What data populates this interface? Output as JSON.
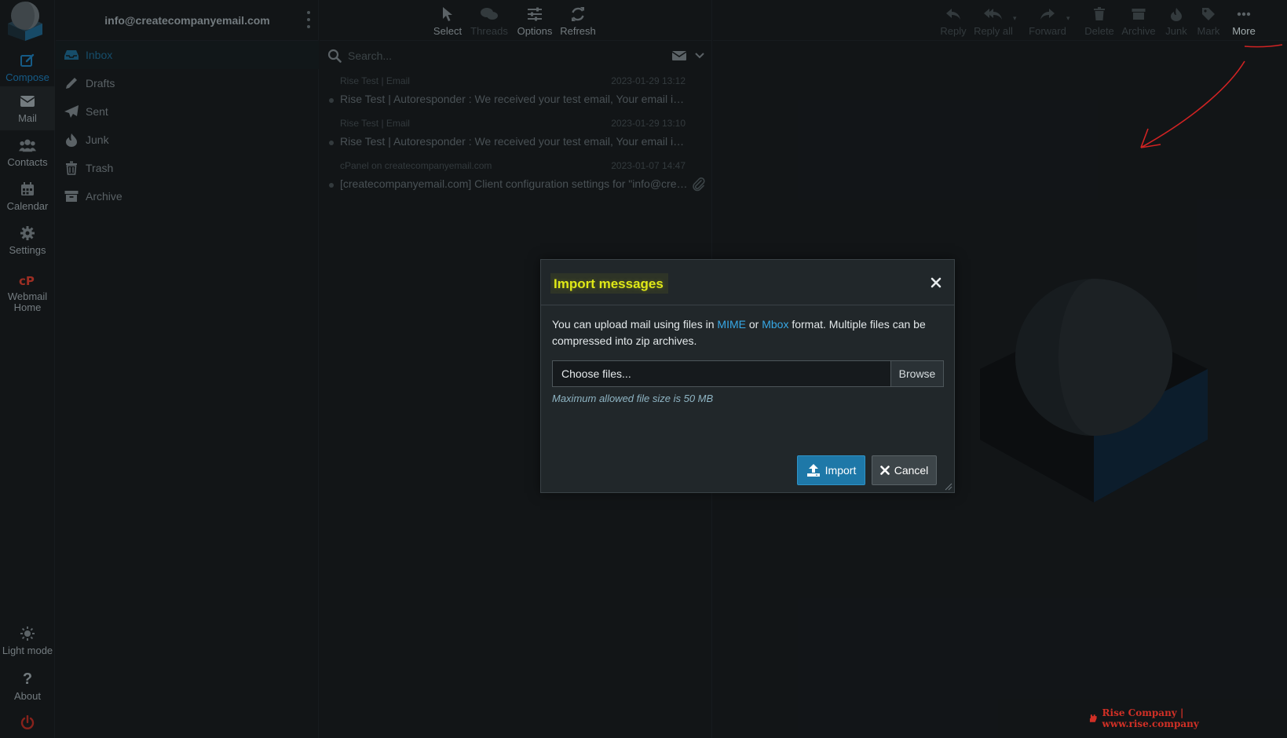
{
  "account": {
    "email": "info@createcompanyemail.com"
  },
  "rail": {
    "compose": "Compose",
    "mail": "Mail",
    "contacts": "Contacts",
    "calendar": "Calendar",
    "settings": "Settings",
    "webmail_home_1": "Webmail",
    "webmail_home_2": "Home",
    "light_mode": "Light mode",
    "about": "About"
  },
  "folders": [
    {
      "label": "Inbox",
      "icon": "inbox-icon"
    },
    {
      "label": "Drafts",
      "icon": "pencil-icon"
    },
    {
      "label": "Sent",
      "icon": "paper-plane-icon"
    },
    {
      "label": "Junk",
      "icon": "fire-icon"
    },
    {
      "label": "Trash",
      "icon": "trash-icon"
    },
    {
      "label": "Archive",
      "icon": "archive-icon"
    }
  ],
  "list_toolbar": {
    "select": "Select",
    "threads": "Threads",
    "options": "Options",
    "refresh": "Refresh"
  },
  "search": {
    "placeholder": "Search..."
  },
  "messages": [
    {
      "from": "Rise Test | Email",
      "date": "2023-01-29 13:12",
      "subject": "Rise Test | Autoresponder : We received your test email, Your email is working fine"
    },
    {
      "from": "Rise Test | Email",
      "date": "2023-01-29 13:10",
      "subject": "Rise Test | Autoresponder : We received your test email, Your email is working fine"
    },
    {
      "from": "cPanel on createcompanyemail.com",
      "date": "2023-01-07 14:47",
      "subject": "[createcompanyemail.com] Client configuration settings for \"info@createcompanyemail.com\"",
      "has_attachment": true
    }
  ],
  "preview_toolbar": {
    "reply": "Reply",
    "reply_all": "Reply all",
    "forward": "Forward",
    "delete": "Delete",
    "archive": "Archive",
    "junk": "Junk",
    "mark": "Mark",
    "more": "More"
  },
  "dialog": {
    "title": "Import messages",
    "text_before": "You can upload mail using files in ",
    "mime": "MIME",
    "or": " or ",
    "mbox": "Mbox",
    "text_after": " format. Multiple files can be compressed into zip archives.",
    "file_placeholder": "Choose files...",
    "browse": "Browse",
    "hint": "Maximum allowed file size is 50 MB",
    "import": "Import",
    "cancel": "Cancel"
  },
  "brand": {
    "text": "Rise Company | www.rise.company"
  },
  "colors": {
    "accent": "#1e78a8",
    "link": "#37a8e6",
    "highlight": "#dfe817",
    "annotation": "#ff2b2b"
  }
}
